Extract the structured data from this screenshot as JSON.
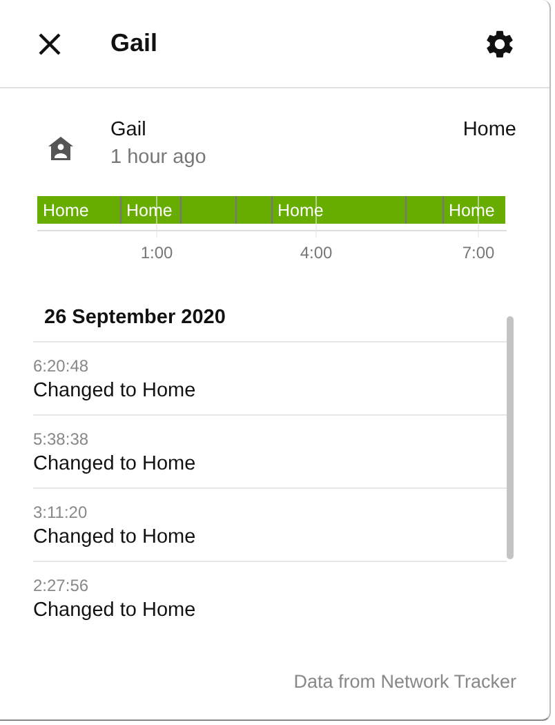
{
  "header": {
    "title": "Gail"
  },
  "entity": {
    "name": "Gail",
    "last_changed": "1 hour ago",
    "state": "Home"
  },
  "timeline": {
    "segments": [
      {
        "kind": "labelled",
        "label": "Home"
      },
      {
        "kind": "labelled",
        "label": "Home"
      },
      {
        "kind": "blank"
      },
      {
        "kind": "blank"
      },
      {
        "kind": "labelled",
        "label": "Home"
      },
      {
        "kind": "blank"
      },
      {
        "kind": "labelled",
        "label": "Home"
      }
    ],
    "axis_labels": [
      "1:00",
      "4:00",
      "7:00"
    ]
  },
  "logbook": {
    "date": "26 September 2020",
    "entries": [
      {
        "time": "6:20:48",
        "message": "Changed to Home"
      },
      {
        "time": "5:38:38",
        "message": "Changed to Home"
      },
      {
        "time": "3:11:20",
        "message": "Changed to Home"
      },
      {
        "time": "2:27:56",
        "message": "Changed to Home"
      }
    ]
  },
  "footer": "Data from Network Tracker"
}
